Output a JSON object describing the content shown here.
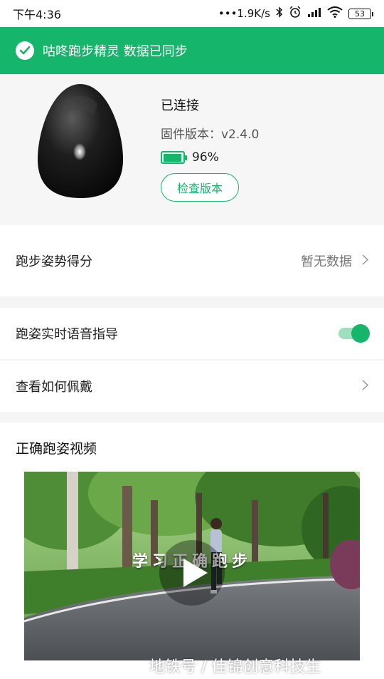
{
  "status_bar": {
    "time": "下午4:36",
    "network_speed": "•••1.9K/s",
    "battery": "53"
  },
  "banner": {
    "text": "咕咚跑步精灵 数据已同步",
    "color": "#15b56b"
  },
  "device": {
    "status": "已连接",
    "firmware": "固件版本：v2.4.0",
    "battery_percent": "96%",
    "battery_level": 0.96,
    "check_button": "检查版本"
  },
  "score_row": {
    "label": "跑步姿势得分",
    "value": "暂无数据"
  },
  "voice_row": {
    "label": "跑姿实时语音指导",
    "enabled": true
  },
  "wear_row": {
    "label": "查看如何佩戴"
  },
  "video": {
    "section_title": "正确跑姿视频",
    "caption": "学习正确跑步"
  },
  "watermark": "地铁号 / 佳锦创意科技生"
}
